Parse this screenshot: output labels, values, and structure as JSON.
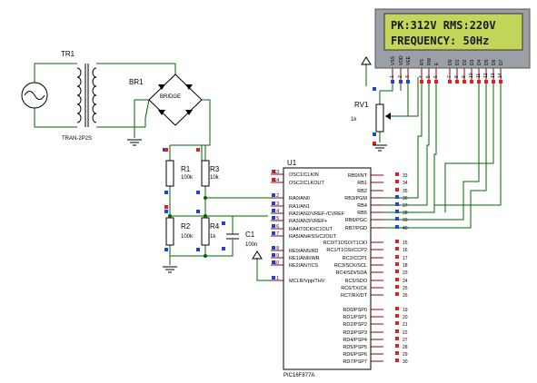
{
  "lcd": {
    "line1": "PK:312V RMS:220V",
    "line2": "FREQUENCY: 50Hz",
    "pin_names": [
      "VSS",
      "VDD",
      "VEE",
      "RS",
      "RW",
      "E",
      "D0",
      "D1",
      "D2",
      "D3",
      "D4",
      "D5",
      "D6",
      "D7"
    ],
    "pin_numbers": [
      "1",
      "2",
      "3",
      "4",
      "5",
      "6",
      "7",
      "8",
      "9",
      "10",
      "11",
      "12",
      "13",
      "14"
    ]
  },
  "transformer": {
    "ref": "TR1",
    "model": "TRAN-2P2S"
  },
  "bridge": {
    "ref": "BR1",
    "model": "BRIDGE"
  },
  "resistors": [
    {
      "ref": "R1",
      "value": "100k"
    },
    {
      "ref": "R3",
      "value": "10k"
    },
    {
      "ref": "R2",
      "value": "100k"
    },
    {
      "ref": "R4",
      "value": "1k"
    }
  ],
  "capacitor": {
    "ref": "C1",
    "value": "100n"
  },
  "pot": {
    "ref": "RV1",
    "value": "1k"
  },
  "mcu": {
    "ref": "U1",
    "part": "PIC16F877A",
    "left_pins": [
      {
        "num": "13",
        "name": "OSC1/CLKIN"
      },
      {
        "num": "14",
        "name": "OSC2/CLKOUT"
      },
      {
        "num": "2",
        "name": "RA0/AN0"
      },
      {
        "num": "3",
        "name": "RA1/AN1"
      },
      {
        "num": "4",
        "name": "RA2/AN2/VREF-/CVREF"
      },
      {
        "num": "5",
        "name": "RA3/AN3/VREF+"
      },
      {
        "num": "6",
        "name": "RA4/T0CKI/C1OUT"
      },
      {
        "num": "7",
        "name": "RA5/AN4/SS/C2OUT"
      },
      {
        "num": "8",
        "name": "RE0/AN5/RD"
      },
      {
        "num": "9",
        "name": "RE1/AN6/WR"
      },
      {
        "num": "10",
        "name": "RE2/AN7/CS"
      },
      {
        "num": "1",
        "name": "MCLR/Vpp/THV"
      }
    ],
    "right_pins": [
      {
        "num": "33",
        "name": "RB0/INT"
      },
      {
        "num": "34",
        "name": "RB1"
      },
      {
        "num": "35",
        "name": "RB2"
      },
      {
        "num": "36",
        "name": "RB3/PGM"
      },
      {
        "num": "37",
        "name": "RB4"
      },
      {
        "num": "38",
        "name": "RB5"
      },
      {
        "num": "39",
        "name": "RB6/PGC"
      },
      {
        "num": "40",
        "name": "RB7/PGD"
      },
      {
        "num": "15",
        "name": "RC0/T1OSO/T1CKI"
      },
      {
        "num": "16",
        "name": "RC1/T1OSI/CCP2"
      },
      {
        "num": "17",
        "name": "RC2/CCP1"
      },
      {
        "num": "18",
        "name": "RC3/SCK/SCL"
      },
      {
        "num": "23",
        "name": "RC4/SDI/SDA"
      },
      {
        "num": "24",
        "name": "RC5/SDO"
      },
      {
        "num": "25",
        "name": "RC6/TX/CK"
      },
      {
        "num": "26",
        "name": "RC7/RX/DT"
      },
      {
        "num": "19",
        "name": "RD0/PSP0"
      },
      {
        "num": "20",
        "name": "RD1/PSP1"
      },
      {
        "num": "21",
        "name": "RD2/PSP2"
      },
      {
        "num": "22",
        "name": "RD3/PSP3"
      },
      {
        "num": "27",
        "name": "RD4/PSP4"
      },
      {
        "num": "28",
        "name": "RD5/PSP5"
      },
      {
        "num": "29",
        "name": "RD6/PSP6"
      },
      {
        "num": "30",
        "name": "RD7/PSP7"
      }
    ]
  },
  "colors": {
    "wire": "#006400",
    "body": "#000000",
    "pin": "#8b0000",
    "lcd_bg": "#c3d65a",
    "lcd_frame": "#9aa0a6",
    "pin_red": "#e02020",
    "pin_blue": "#2040e0",
    "ic_fill": "#ffffff"
  }
}
